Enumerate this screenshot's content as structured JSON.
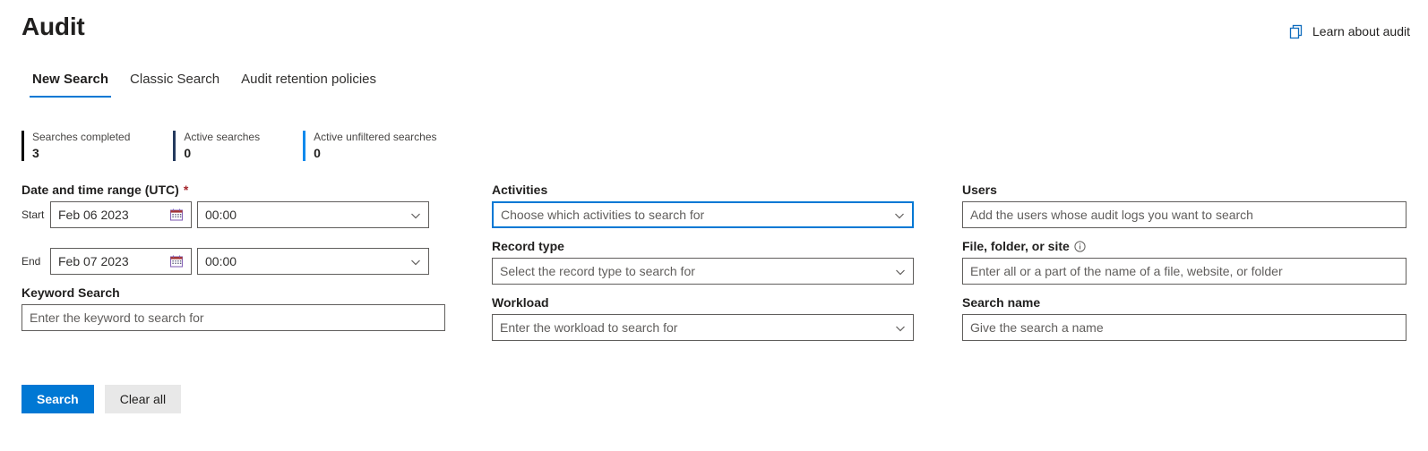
{
  "header": {
    "title": "Audit",
    "learn_link_label": "Learn about audit",
    "learn_link_icon": "documents-icon"
  },
  "tabs": [
    {
      "label": "New Search",
      "active": true
    },
    {
      "label": "Classic Search",
      "active": false
    },
    {
      "label": "Audit retention policies",
      "active": false
    }
  ],
  "stats": [
    {
      "label": "Searches completed",
      "value": "3",
      "bar_color": "#000000"
    },
    {
      "label": "Active searches",
      "value": "0",
      "bar_color": "#243a5e"
    },
    {
      "label": "Active unfiltered searches",
      "value": "0",
      "bar_color": "#0f8aec"
    }
  ],
  "form": {
    "date_range": {
      "label": "Date and time range (UTC)",
      "required_marker": "*",
      "start_tag": "Start",
      "start_date_value": "Feb 06 2023",
      "start_time_value": "00:00",
      "end_tag": "End",
      "end_date_value": "Feb 07 2023",
      "end_time_value": "00:00",
      "calendar_icon": "calendar-icon",
      "chevron_icon": "chevron-down-icon"
    },
    "keyword_search": {
      "label": "Keyword Search",
      "placeholder": "Enter the keyword to search for"
    },
    "activities": {
      "label": "Activities",
      "placeholder": "Choose which activities to search for",
      "focused": true
    },
    "record_type": {
      "label": "Record type",
      "placeholder": "Select the record type to search for"
    },
    "workload": {
      "label": "Workload",
      "placeholder": "Enter the workload to search for"
    },
    "users": {
      "label": "Users",
      "placeholder": "Add the users whose audit logs you want to search"
    },
    "file_folder_site": {
      "label": "File, folder, or site",
      "info_icon": "info-icon",
      "placeholder": "Enter all or a part of the name of a file, website, or folder"
    },
    "search_name": {
      "label": "Search name",
      "placeholder": "Give the search a name"
    }
  },
  "buttons": {
    "search_label": "Search",
    "clear_all_label": "Clear all"
  },
  "colors": {
    "accent": "#0078d4",
    "required": "#a4262c",
    "border": "#605e5c"
  }
}
